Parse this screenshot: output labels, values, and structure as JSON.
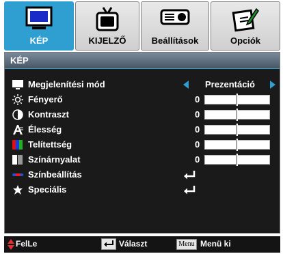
{
  "tabs": [
    {
      "label": "KÉP",
      "icon": "monitor-icon",
      "active": true
    },
    {
      "label": "KIJELZŐ",
      "icon": "tv-icon",
      "active": false
    },
    {
      "label": "Beállítások",
      "icon": "projector-icon",
      "active": false
    },
    {
      "label": "Opciók",
      "icon": "edit-icon",
      "active": false
    }
  ],
  "section_title": "KÉP",
  "rows": [
    {
      "label": "Megjelenítési mód",
      "value": "Prezentáció",
      "icon": "monitor-icon",
      "type": "select"
    },
    {
      "label": "Fényerő",
      "value": "0",
      "icon": "sun-icon",
      "type": "slider",
      "level": 0.5
    },
    {
      "label": "Kontraszt",
      "value": "0",
      "icon": "contrast-icon",
      "type": "slider",
      "level": 0.5
    },
    {
      "label": "Élesség",
      "value": "0",
      "icon": "sharpness-icon",
      "type": "slider",
      "level": 0.5
    },
    {
      "label": "Telítettség",
      "value": "0",
      "icon": "saturation-icon",
      "type": "slider",
      "level": 0.5
    },
    {
      "label": "Színárnyalat",
      "value": "0",
      "icon": "tint-icon",
      "type": "slider",
      "level": 0.5
    },
    {
      "label": "Színbeállítás",
      "icon": "color-settings-icon",
      "type": "enter"
    },
    {
      "label": "Speciális",
      "icon": "advanced-icon",
      "type": "enter"
    }
  ],
  "footer": {
    "move_label": "FelLe",
    "select_label": "Választ",
    "menu_key": "Menu",
    "exit_label": "Menü ki"
  },
  "colors": {
    "accent": "#2f9fd1",
    "panel": "#1a1a1a"
  }
}
